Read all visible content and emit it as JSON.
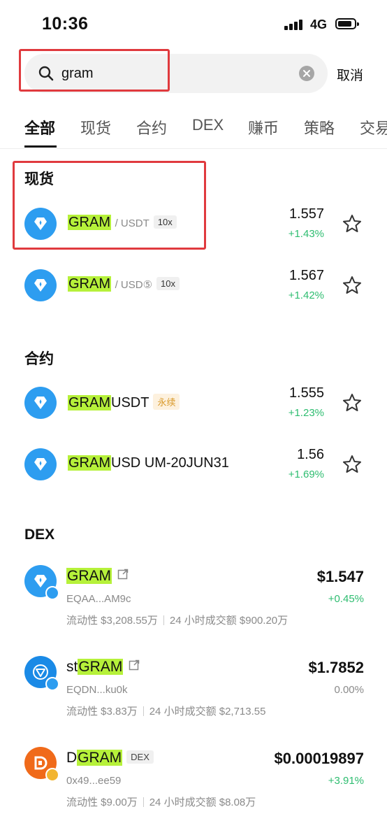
{
  "status_bar": {
    "time": "10:36",
    "network": "4G"
  },
  "search": {
    "query": "gram",
    "placeholder": "",
    "cancel_label": "取消"
  },
  "tabs": [
    {
      "label": "全部",
      "active": true
    },
    {
      "label": "现货",
      "active": false
    },
    {
      "label": "合约",
      "active": false
    },
    {
      "label": "DEX",
      "active": false
    },
    {
      "label": "赚币",
      "active": false
    },
    {
      "label": "策略",
      "active": false
    },
    {
      "label": "交易",
      "active": false
    }
  ],
  "spot": {
    "title": "现货",
    "items": [
      {
        "base": "GRAM",
        "quote": "/ USDT",
        "leverage": "10x",
        "price": "1.557",
        "change": "+1.43%"
      },
      {
        "base": "GRAM",
        "quote": "/ USD⑤",
        "leverage": "10x",
        "price": "1.567",
        "change": "+1.42%"
      }
    ]
  },
  "futures": {
    "title": "合约",
    "items": [
      {
        "base": "GRAM",
        "suffix": "USDT",
        "tag": "永续",
        "price": "1.555",
        "change": "+1.23%"
      },
      {
        "base": "GRAM",
        "suffix": "USD UM-20JUN31",
        "tag": "",
        "price": "1.56",
        "change": "+1.69%"
      }
    ]
  },
  "dex": {
    "title": "DEX",
    "items": [
      {
        "prefix": "",
        "base": "GRAM",
        "badge": "",
        "address": "EQAA...AM9c",
        "liquidity": "流动性 $3,208.55万",
        "volume": "24 小时成交额 $900.20万",
        "price": "$1.547",
        "change": "+0.45%",
        "change_color": "#2ebd70"
      },
      {
        "prefix": "st",
        "base": "GRAM",
        "badge": "",
        "address": "EQDN...ku0k",
        "liquidity": "流动性 $3.83万",
        "volume": "24 小时成交额 $2,713.55",
        "price": "$1.7852",
        "change": "0.00%",
        "change_color": "#8a8a8a"
      },
      {
        "prefix": "D",
        "base": "GRAM",
        "badge": "DEX",
        "address": "0x49...ee59",
        "liquidity": "流动性 $9.00万",
        "volume": "24 小时成交额 $8.08万",
        "price": "$0.00019897",
        "change": "+3.91%",
        "change_color": "#2ebd70"
      }
    ]
  },
  "colors": {
    "highlight": "#b6f13a",
    "up": "#2ebd70",
    "accent_box": "#e03a3e"
  }
}
